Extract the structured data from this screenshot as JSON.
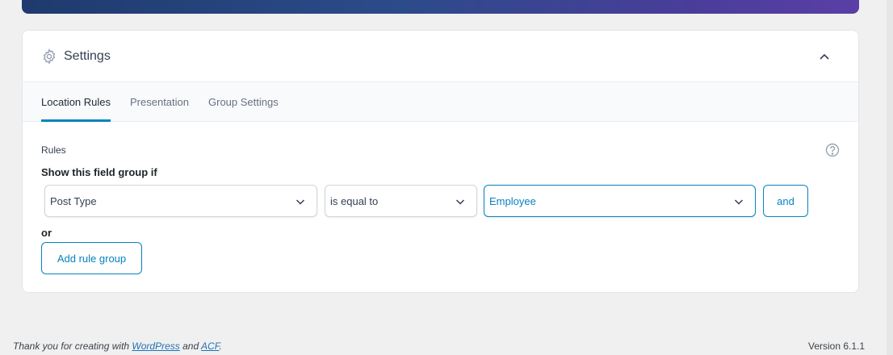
{
  "panel": {
    "title": "Settings",
    "tabs": [
      {
        "label": "Location Rules",
        "active": true
      },
      {
        "label": "Presentation",
        "active": false
      },
      {
        "label": "Group Settings",
        "active": false
      }
    ]
  },
  "rules": {
    "label": "Rules",
    "show_if": "Show this field group if",
    "param_value": "Post Type",
    "operator_value": "is equal to",
    "value_value": "Employee",
    "and_label": "and",
    "or_label": "or",
    "add_group_label": "Add rule group"
  },
  "footer": {
    "thanks_prefix": "Thank you for creating with",
    "wordpress_link": "WordPress",
    "and_text": "and",
    "acf_link": "ACF",
    "version": "Version 6.1.1"
  },
  "colors": {
    "accent": "#0783be",
    "link": "#2271b1",
    "page_bg": "#f0f0f1"
  },
  "icons": {
    "settings": "gear-icon",
    "collapse": "chevron-up-icon",
    "help": "question-circle-icon",
    "dropdown": "chevron-down-icon"
  }
}
